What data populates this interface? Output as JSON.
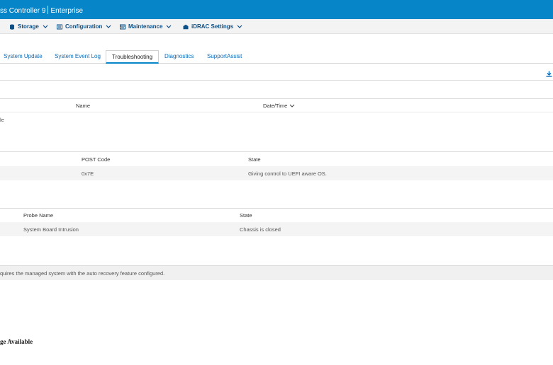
{
  "header": {
    "title": "ss Controller 9",
    "edition": "Enterprise"
  },
  "menu": [
    {
      "label": "Storage",
      "icon": "storage-icon"
    },
    {
      "label": "Configuration",
      "icon": "configuration-icon"
    },
    {
      "label": "Maintenance",
      "icon": "maintenance-icon"
    },
    {
      "label": "iDRAC Settings",
      "icon": "idrac-settings-icon"
    }
  ],
  "tabs": [
    {
      "label": "System Update"
    },
    {
      "label": "System Event Log"
    },
    {
      "label": "Troubleshooting",
      "active": true
    },
    {
      "label": "Diagnostics"
    },
    {
      "label": "SupportAssist"
    }
  ],
  "crash_table": {
    "headers": {
      "name": "Name",
      "datetime": "Date/Time"
    },
    "message": "le"
  },
  "post_table": {
    "headers": {
      "code": "POST Code",
      "state": "State"
    },
    "rows": [
      {
        "code": "0x7E",
        "state": "Giving control to UEFI aware OS."
      }
    ]
  },
  "intrusion_table": {
    "headers": {
      "probe": "Probe Name",
      "state": "State"
    },
    "rows": [
      {
        "probe": "System Board Intrusion",
        "state": "Chassis is closed"
      }
    ]
  },
  "recovery_note": "quires the managed system with the auto recovery feature configured.",
  "image_status": "ge Available",
  "colors": {
    "header_blue": "#0685c9",
    "menu_text": "#0d4f87",
    "link_blue": "#0d6ab6"
  }
}
